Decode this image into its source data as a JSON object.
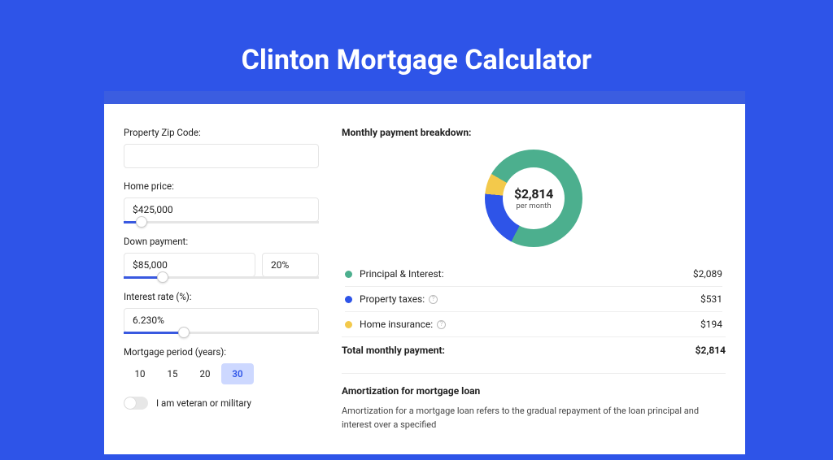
{
  "title": "Clinton Mortgage Calculator",
  "form": {
    "zip": {
      "label": "Property Zip Code:",
      "value": ""
    },
    "home_price": {
      "label": "Home price:",
      "value": "$425,000",
      "slider_pct": 9
    },
    "down_payment": {
      "label": "Down payment:",
      "value": "$85,000",
      "pct": "20%",
      "slider_pct": 20
    },
    "interest": {
      "label": "Interest rate (%):",
      "value": "6.230%",
      "slider_pct": 31
    },
    "period": {
      "label": "Mortgage period (years):",
      "options": [
        "10",
        "15",
        "20",
        "30"
      ],
      "selected": "30"
    },
    "veteran": {
      "label": "I am veteran or military",
      "on": false
    }
  },
  "breakdown": {
    "title": "Monthly payment breakdown:",
    "center_value": "$2,814",
    "center_sub": "per month",
    "rows": [
      {
        "label": "Principal & Interest:",
        "value": "$2,089",
        "color": "#4caf8e",
        "info": false
      },
      {
        "label": "Property taxes:",
        "value": "$531",
        "color": "#2e54e8",
        "info": true
      },
      {
        "label": "Home insurance:",
        "value": "$194",
        "color": "#f3c94b",
        "info": true
      }
    ],
    "total_label": "Total monthly payment:",
    "total_value": "$2,814"
  },
  "chart_data": {
    "type": "pie",
    "title": "Monthly payment breakdown",
    "series": [
      {
        "name": "Principal & Interest",
        "value": 2089,
        "color": "#4caf8e"
      },
      {
        "name": "Property taxes",
        "value": 531,
        "color": "#2e54e8"
      },
      {
        "name": "Home insurance",
        "value": 194,
        "color": "#f3c94b"
      }
    ],
    "total": 2814,
    "center_label": "$2,814 per month"
  },
  "amortization": {
    "title": "Amortization for mortgage loan",
    "body": "Amortization for a mortgage loan refers to the gradual repayment of the loan principal and interest over a specified"
  }
}
